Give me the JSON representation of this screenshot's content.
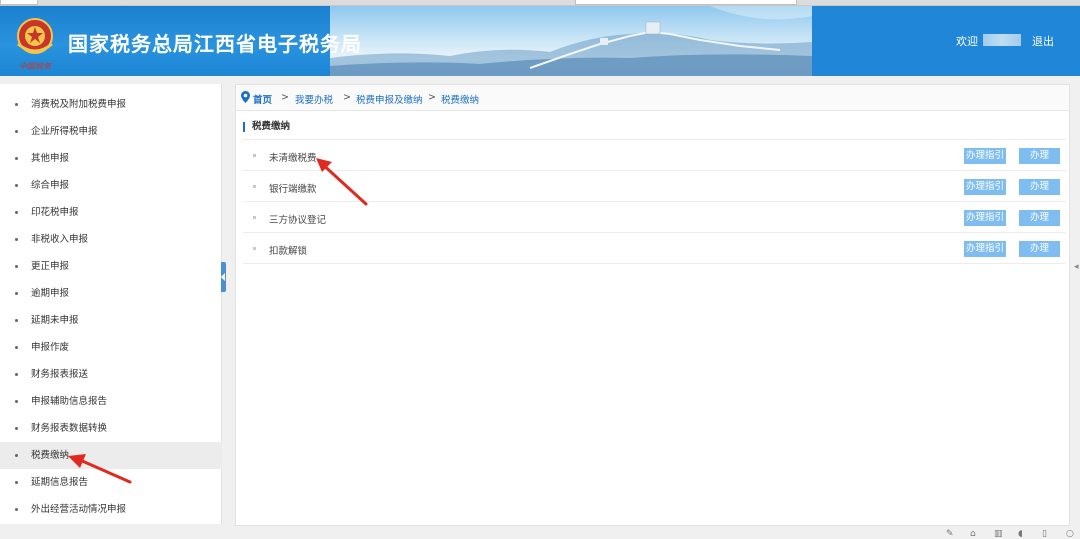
{
  "header": {
    "site_title": "国家税务总局江西省电子税务局",
    "welcome_label": "欢迎",
    "logout_label": "退出",
    "logo_text": "中国税务"
  },
  "sidebar": {
    "items": [
      {
        "label": "消费税及附加税费申报"
      },
      {
        "label": "企业所得税申报"
      },
      {
        "label": "其他申报"
      },
      {
        "label": "综合申报"
      },
      {
        "label": "印花税申报"
      },
      {
        "label": "非税收入申报"
      },
      {
        "label": "更正申报"
      },
      {
        "label": "逾期申报"
      },
      {
        "label": "延期未申报"
      },
      {
        "label": "申报作废"
      },
      {
        "label": "财务报表报送"
      },
      {
        "label": "申报辅助信息报告"
      },
      {
        "label": "财务报表数据转换"
      },
      {
        "label": "税费缴纳"
      },
      {
        "label": "延期信息报告"
      },
      {
        "label": "外出经营活动情况申报"
      }
    ],
    "active_item": "税费缴纳"
  },
  "breadcrumb": {
    "home": "首页",
    "level1": "我要办税",
    "level2": "税费申报及缴纳",
    "level3": "税费缴纳",
    "separator": ">"
  },
  "main": {
    "section_title": "税费缴纳",
    "rows": [
      {
        "label": "未清缴税费",
        "guide_label": "办理指引",
        "action_label": "办理"
      },
      {
        "label": "银行端缴款",
        "guide_label": "办理指引",
        "action_label": "办理"
      },
      {
        "label": "三方协议登记",
        "guide_label": "办理指引",
        "action_label": "办理"
      },
      {
        "label": "扣款解锁",
        "guide_label": "办理指引",
        "action_label": "办理"
      }
    ]
  },
  "colors": {
    "header_blue": "#1f86d8",
    "link_blue": "#1b6fc5",
    "button_blue": "#7fbdf1",
    "annotation_red": "#e02a1f"
  },
  "icons": [
    "location-pin-icon",
    "tax-emblem-icon",
    "collapse-arrow-icon"
  ]
}
